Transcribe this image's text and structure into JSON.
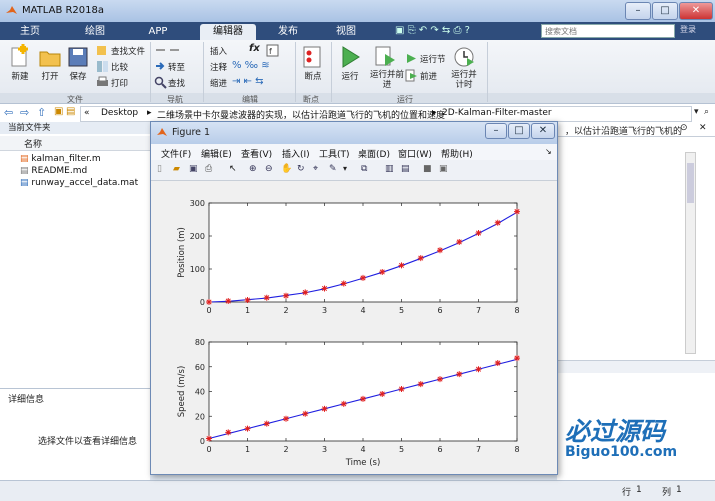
{
  "window": {
    "title": "MATLAB R2018a"
  },
  "tabs": [
    {
      "label": "主页"
    },
    {
      "label": "绘图"
    },
    {
      "label": "APP"
    },
    {
      "label": "编辑器"
    },
    {
      "label": "发布"
    },
    {
      "label": "视图"
    }
  ],
  "search": {
    "placeholder": "搜索文档",
    "signin": "登录"
  },
  "ribbon": {
    "file": {
      "new": "新建",
      "open": "打开",
      "save": "保存",
      "find_files": "查找文件",
      "compare": "比较",
      "print": "打印",
      "group": "文件"
    },
    "navigate": {
      "goto": "转至",
      "find": "查找",
      "group": "导航"
    },
    "edit": {
      "insert": "插入",
      "comment": "注释",
      "indent": "缩进",
      "fx": "fx",
      "group": "编辑"
    },
    "breakpoints": {
      "label": "断点",
      "group": "断点"
    },
    "run": {
      "run": "运行",
      "run_advance": "运行并前进",
      "run_section": "运行节",
      "advance": "前进",
      "run_time": "运行并计时",
      "group": "运行"
    }
  },
  "address": {
    "segments": [
      "«",
      "Desktop",
      "二维场景中卡尔曼滤波器的实现，以估计沿跑道飞行的飞机的位置和速度",
      "2D-Kalman-Filter-master"
    ],
    "right_snippet": "，以估计沿跑道飞行的飞机的"
  },
  "current_folder": {
    "title": "当前文件夹",
    "column": "名称",
    "files": [
      {
        "name": "kalman_filter.m",
        "icon": "m-file-icon"
      },
      {
        "name": "README.md",
        "icon": "text-file-icon"
      },
      {
        "name": "runway_accel_data.mat",
        "icon": "mat-file-icon"
      }
    ]
  },
  "details": {
    "title": "详细信息",
    "placeholder": "选择文件以查看详细信息"
  },
  "status": {
    "row_label": "行",
    "row": "1",
    "col_label": "列",
    "col": "1"
  },
  "figure": {
    "title": "Figure 1",
    "menu": [
      "文件(F)",
      "编辑(E)",
      "查看(V)",
      "插入(I)",
      "工具(T)",
      "桌面(D)",
      "窗口(W)",
      "帮助(H)"
    ]
  },
  "watermark": {
    "text": "必过源码",
    "url": "Biguo100.com"
  },
  "colors": {
    "ribbon_tab": "#2f4d7c",
    "line": "#1f1fe0",
    "marker": "#e02020"
  },
  "chart_data": [
    {
      "type": "line",
      "xlabel": "",
      "ylabel": "Position (m)",
      "xlim": [
        0,
        8
      ],
      "ylim": [
        0,
        300
      ],
      "xticks": [
        0,
        1,
        2,
        3,
        4,
        5,
        6,
        7,
        8
      ],
      "yticks": [
        0,
        100,
        200,
        300
      ],
      "series": [
        {
          "style": "line",
          "x": [
            0,
            0.5,
            1,
            1.5,
            2,
            2.5,
            3,
            3.5,
            4,
            4.5,
            5,
            5.5,
            6,
            6.5,
            7,
            7.5,
            8
          ],
          "values": [
            0,
            2,
            7,
            12,
            20,
            28,
            40,
            55,
            72,
            90,
            110,
            132,
            155,
            180,
            208,
            238,
            272
          ]
        },
        {
          "style": "markers",
          "x": [
            0,
            0.5,
            1,
            1.5,
            2,
            2.5,
            3,
            3.5,
            4,
            4.5,
            5,
            5.5,
            6,
            6.5,
            7,
            7.5,
            8
          ],
          "values": [
            0,
            3,
            6,
            13,
            19,
            29,
            41,
            56,
            73,
            91,
            111,
            133,
            157,
            182,
            209,
            240,
            274
          ]
        }
      ]
    },
    {
      "type": "line",
      "xlabel": "Time (s)",
      "ylabel": "Speed (m/s)",
      "xlim": [
        0,
        8
      ],
      "ylim": [
        0,
        80
      ],
      "xticks": [
        0,
        1,
        2,
        3,
        4,
        5,
        6,
        7,
        8
      ],
      "yticks": [
        0,
        20,
        40,
        60,
        80
      ],
      "series": [
        {
          "style": "line",
          "x": [
            0,
            0.5,
            1,
            1.5,
            2,
            2.5,
            3,
            3.5,
            4,
            4.5,
            5,
            5.5,
            6,
            6.5,
            7,
            7.5,
            8
          ],
          "values": [
            2,
            6,
            10,
            14,
            18,
            22,
            26,
            30,
            34,
            38,
            42,
            46,
            50,
            54,
            58,
            62,
            66
          ]
        },
        {
          "style": "markers",
          "x": [
            0,
            0.5,
            1,
            1.5,
            2,
            2.5,
            3,
            3.5,
            4,
            4.5,
            5,
            5.5,
            6,
            6.5,
            7,
            7.5,
            8
          ],
          "values": [
            2,
            7,
            10,
            14,
            18,
            22,
            26,
            30,
            34,
            38,
            42,
            46,
            50,
            54,
            58,
            63,
            67
          ]
        }
      ]
    }
  ]
}
